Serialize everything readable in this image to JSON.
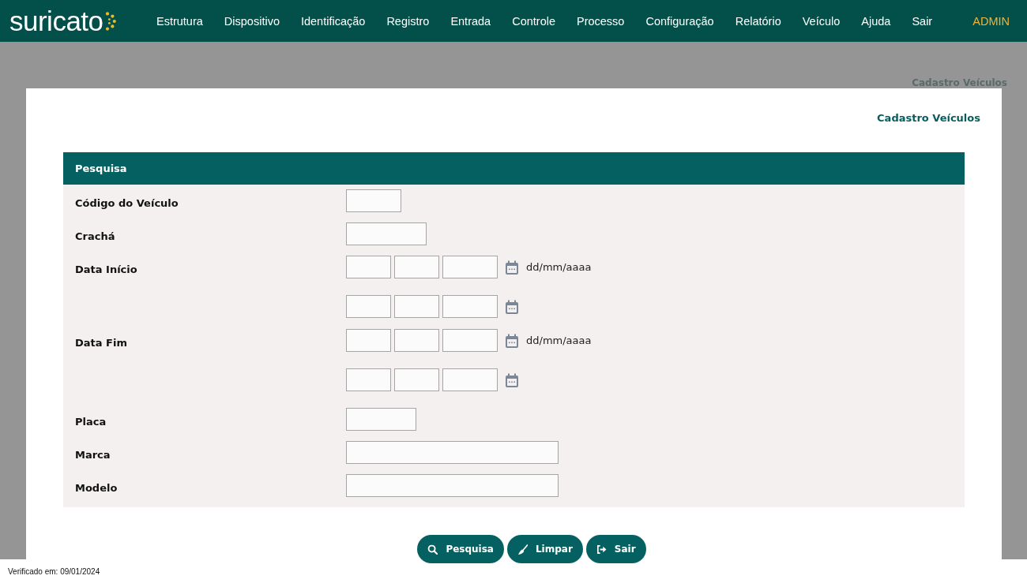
{
  "brand": {
    "name": "suricato"
  },
  "menu": [
    {
      "label": "Estrutura",
      "kind": "link"
    },
    {
      "label": "Dispositivo",
      "kind": "link"
    },
    {
      "label": "Identificação",
      "kind": "link"
    },
    {
      "label": "Registro",
      "kind": "link"
    },
    {
      "label": "Entrada",
      "kind": "link"
    },
    {
      "label": "Controle",
      "kind": "link"
    },
    {
      "label": "Processo",
      "kind": "link"
    },
    {
      "label": "Configuração",
      "kind": "link"
    },
    {
      "label": "Relatório",
      "kind": "link"
    },
    {
      "label": "Veículo",
      "kind": "link"
    },
    {
      "label": "Ajuda",
      "kind": "link"
    },
    {
      "label": "Sair",
      "kind": "link"
    },
    {
      "label": "ADMIN",
      "kind": "user"
    }
  ],
  "breadcrumb": "Cadastro Veículos",
  "page_title": "Cadastro Veículos",
  "panel": {
    "title": "Pesquisa",
    "rows": [
      {
        "label": "Código do Veículo",
        "kind": "small"
      },
      {
        "label": "Crachá",
        "kind": "medium"
      },
      {
        "label": "Data Início",
        "kind": "date",
        "hint": "dd/mm/aaaa"
      },
      {
        "kind": "date"
      },
      {
        "label": "Data Fim",
        "kind": "date",
        "hint": "dd/mm/aaaa"
      },
      {
        "kind": "date"
      },
      {
        "label": "Placa",
        "kind": "plate"
      },
      {
        "label": "Marca",
        "kind": "large"
      },
      {
        "label": "Modelo",
        "kind": "large"
      }
    ]
  },
  "buttons": [
    {
      "label": "Pesquisa",
      "kind": "search"
    },
    {
      "label": "Limpar",
      "kind": "clear"
    },
    {
      "label": "Sair",
      "kind": "exit"
    }
  ],
  "footer": "Verificado em: 09/01/2024"
}
